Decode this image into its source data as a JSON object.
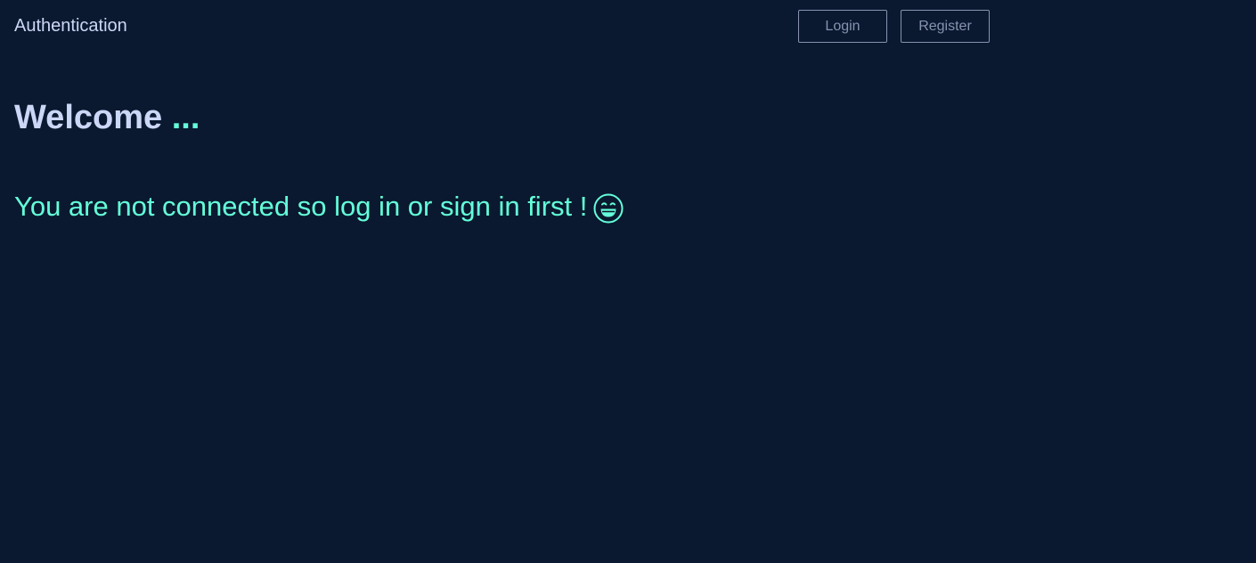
{
  "header": {
    "brand": "Authentication",
    "login_label": "Login",
    "register_label": "Register"
  },
  "main": {
    "welcome": "Welcome",
    "welcome_dots": "...",
    "message": "You are not connected so log in or sign in first !",
    "message_icon": "grinning-face-icon"
  },
  "colors": {
    "background": "#0a192f",
    "primary_text": "#ccd6f6",
    "accent": "#64ffda",
    "muted": "#8892b0"
  }
}
